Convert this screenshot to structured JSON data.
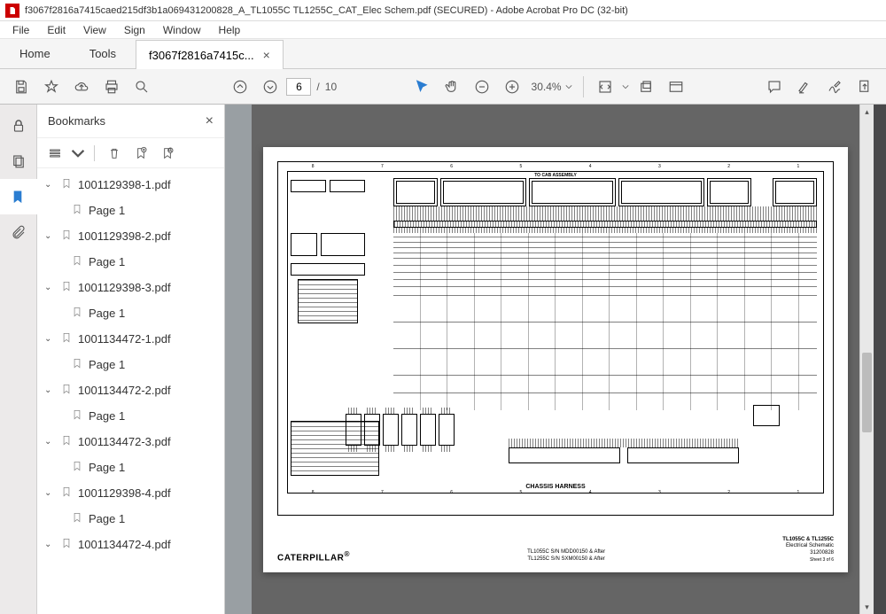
{
  "window": {
    "title": "f3067f2816a7415caed215df3b1a069431200828_A_TL1055C TL1255C_CAT_Elec Schem.pdf (SECURED) - Adobe Acrobat Pro DC (32-bit)"
  },
  "menu": {
    "items": [
      "File",
      "Edit",
      "View",
      "Sign",
      "Window",
      "Help"
    ]
  },
  "tabs": {
    "home": "Home",
    "tools": "Tools",
    "doc_name": "f3067f2816a7415c..."
  },
  "toolbar": {
    "page_current": "6",
    "page_sep": "/",
    "page_total": "10",
    "zoom": "30.4%"
  },
  "panel": {
    "title": "Bookmarks",
    "tree": [
      {
        "label": "1001129398-1.pdf",
        "children": [
          {
            "label": "Page 1"
          }
        ]
      },
      {
        "label": "1001129398-2.pdf",
        "children": [
          {
            "label": "Page 1"
          }
        ]
      },
      {
        "label": "1001129398-3.pdf",
        "children": [
          {
            "label": "Page 1"
          }
        ]
      },
      {
        "label": "1001134472-1.pdf",
        "children": [
          {
            "label": "Page 1"
          }
        ]
      },
      {
        "label": "1001134472-2.pdf",
        "children": [
          {
            "label": "Page 1"
          }
        ]
      },
      {
        "label": "1001134472-3.pdf",
        "children": [
          {
            "label": "Page 1"
          }
        ]
      },
      {
        "label": "1001129398-4.pdf",
        "children": [
          {
            "label": "Page 1"
          }
        ]
      },
      {
        "label": "1001134472-4.pdf",
        "children": []
      }
    ]
  },
  "document": {
    "top_label": "TO CAB ASSEMBLY",
    "chassis_label": "CHASSIS HARNESS",
    "brand": "CATERPILLAR",
    "trademark": "®",
    "center_line1": "TL1055C S/N MDD00150 & After",
    "center_line2": "TL1255C S/N SXM00150 & After",
    "right_line1": "TL1055C & TL1255C",
    "right_line2": "Electrical Schematic",
    "right_line3": "31200828",
    "right_line4": "Sheet 3 of 6"
  }
}
